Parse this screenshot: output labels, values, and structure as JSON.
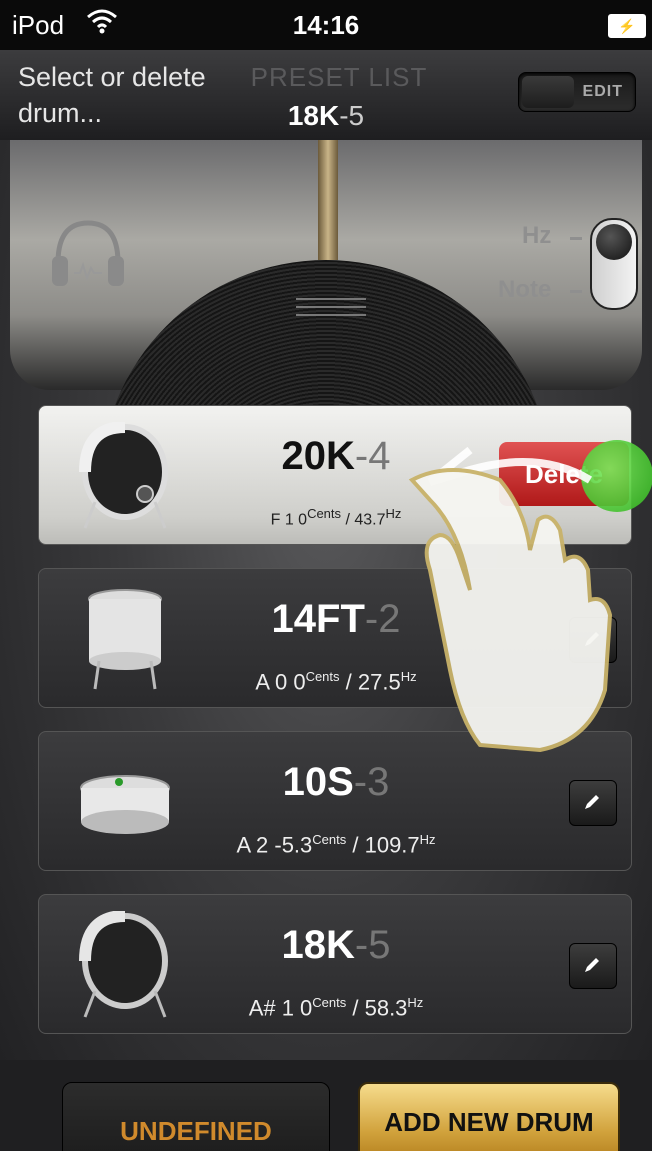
{
  "status_bar": {
    "carrier": "iPod",
    "time": "14:16"
  },
  "header": {
    "hint_line1": "Select or delete",
    "hint_line2": "drum...",
    "title": "PRESET LIST",
    "current_name": "18K",
    "current_suffix": "-5",
    "edit_label": "EDIT"
  },
  "tuner": {
    "hz_label": "Hz",
    "note_label": "Note"
  },
  "drums": [
    {
      "name": "20K",
      "suffix": "-4",
      "note": "F 1 0",
      "cents_label": "Cents",
      "freq": " / 43.7",
      "hz_label": "Hz",
      "delete_label": "Delete"
    },
    {
      "name": "14FT",
      "suffix": "-2",
      "note": "A 0 0",
      "cents_label": "Cents",
      "freq": " / 27.5",
      "hz_label": "Hz"
    },
    {
      "name": "10S",
      "suffix": "-3",
      "note": "A 2 -5.3",
      "cents_label": "Cents",
      "freq": " / 109.7",
      "hz_label": "Hz"
    },
    {
      "name": "18K",
      "suffix": "-5",
      "note": "A# 1 0",
      "cents_label": "Cents",
      "freq": " / 58.3",
      "hz_label": "Hz"
    }
  ],
  "buttons": {
    "undefined_label": "UNDEFINED",
    "add_label": "ADD NEW DRUM"
  }
}
